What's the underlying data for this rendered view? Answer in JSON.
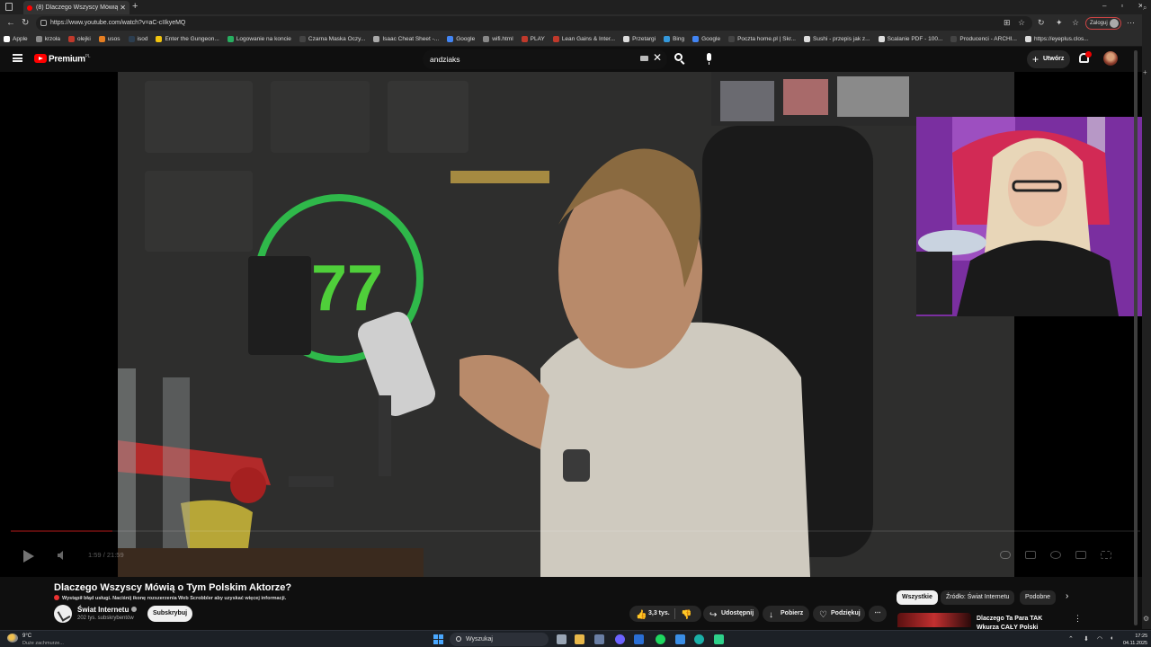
{
  "browser": {
    "tab_title": "(8) Dlaczego Wszyscy Mówią o Ty",
    "url": "https://www.youtube.com/watch?v=aC-cIIkyeMQ",
    "profile_label": "Zaloguj",
    "bookmarks": [
      {
        "label": "Apple",
        "color": "#ffffff"
      },
      {
        "label": "krzoła",
        "color": "#888888"
      },
      {
        "label": "olejki",
        "color": "#c0392b"
      },
      {
        "label": "usos",
        "color": "#e67e22"
      },
      {
        "label": "isod",
        "color": "#2c3e50"
      },
      {
        "label": "Enter the Gungeon...",
        "color": "#f1c40f"
      },
      {
        "label": "Logowanie na koncie",
        "color": "#27ae60"
      },
      {
        "label": "Czarna Maska Oczy...",
        "color": "#444444"
      },
      {
        "label": "Isaac Cheat Sheet -...",
        "color": "#aaaaaa"
      },
      {
        "label": "Google",
        "color": "#4285f4"
      },
      {
        "label": "wifi.html",
        "color": "#888888"
      },
      {
        "label": "PLAY",
        "color": "#c0392b"
      },
      {
        "label": "Lean Gains & Inter...",
        "color": "#c0392b"
      },
      {
        "label": "Przetargi",
        "color": "#dddddd"
      },
      {
        "label": "Bing",
        "color": "#3498db"
      },
      {
        "label": "Google",
        "color": "#4285f4"
      },
      {
        "label": "Poczta home.pl | Skr...",
        "color": "#444444"
      },
      {
        "label": "Sushi - przepis jak z...",
        "color": "#dddddd"
      },
      {
        "label": "Scalanie PDF - 100...",
        "color": "#dddddd"
      },
      {
        "label": "Producenci - ARCHI...",
        "color": "#444444"
      },
      {
        "label": "https://eyeplus.clos...",
        "color": "#dddddd"
      }
    ]
  },
  "youtube": {
    "brand": "Premium",
    "brand_region": "PL",
    "search_query": "andziaks",
    "create_label": "Utwórz",
    "notifications_badge": "9+"
  },
  "player": {
    "time_current": "1:59",
    "time_total": "21:59",
    "progress_fraction": 0.09
  },
  "video": {
    "title": "Dlaczego Wszyscy Mówią o Tym Polskim Aktorze?",
    "notice": "Wystąpił błąd usługi. Naciśnij ikonę rozszerzenia Web Scrobbler aby uzyskać więcej informacji.",
    "channel_name": "Świat Internetu",
    "subscribers": "202 tys. subskrybentów",
    "subscribe_label": "Subskrybuj",
    "likes": "3,3 tys.",
    "share_label": "Udostępnij",
    "download_label": "Pobierz",
    "thanks_label": "Podziękuj"
  },
  "recommendations": {
    "chips": [
      "Wszystkie",
      "Źródło: Świat Internetu",
      "Podobne"
    ],
    "first_title": "Dlaczego Ta Para TAK Wkurza CAŁY Polski Internet?"
  },
  "taskbar": {
    "temperature": "9°C",
    "weather": "Duże zachmurze...",
    "search_placeholder": "Wyszukaj",
    "time": "17:25",
    "date": "04.11.2025"
  }
}
